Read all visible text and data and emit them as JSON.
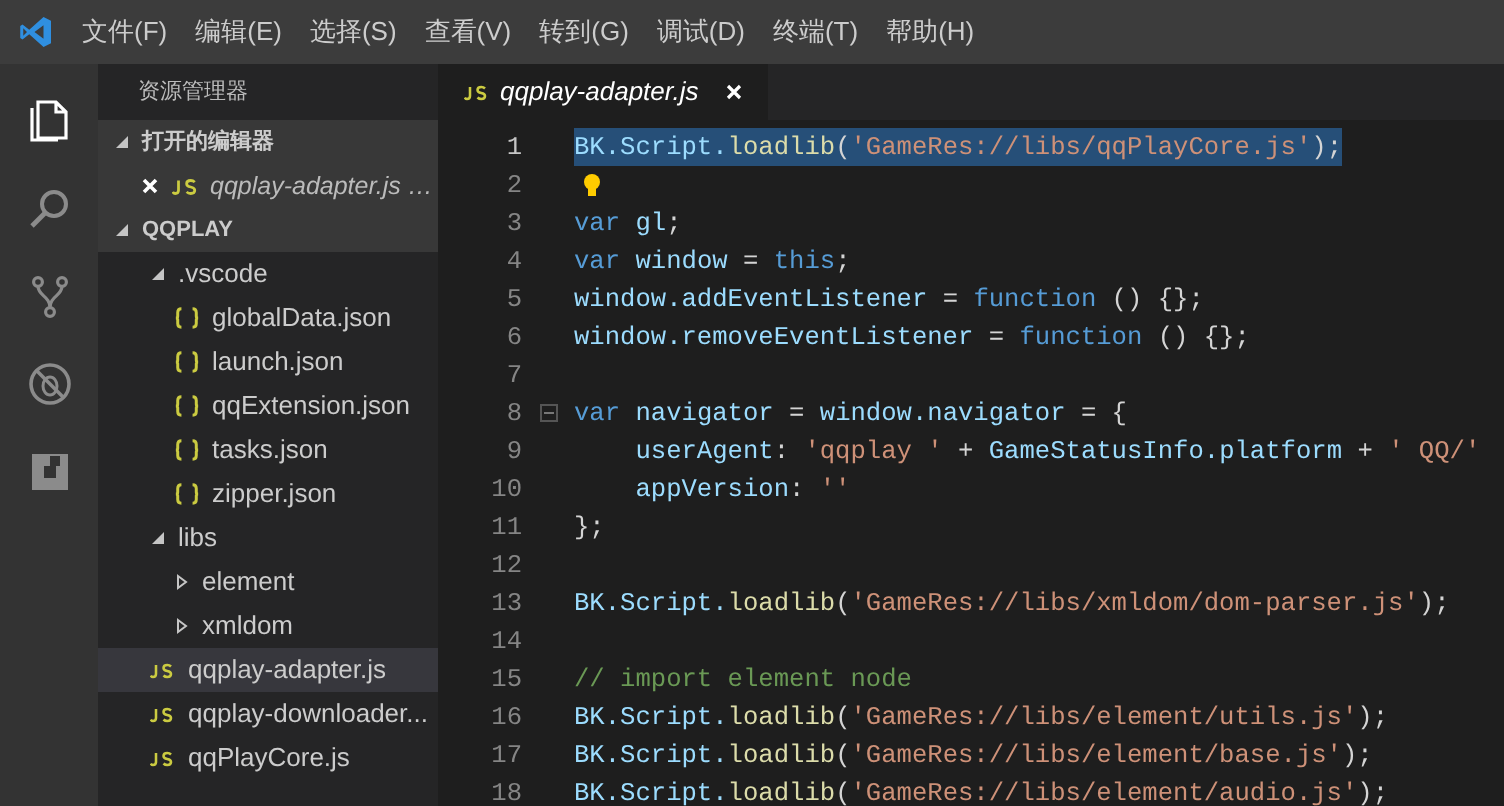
{
  "menu_bar": {
    "items": [
      "文件(F)",
      "编辑(E)",
      "选择(S)",
      "查看(V)",
      "转到(G)",
      "调试(D)",
      "终端(T)",
      "帮助(H)"
    ]
  },
  "activity_bar": {
    "items": [
      {
        "kind": "files",
        "selected": true
      },
      {
        "kind": "search",
        "selected": false
      },
      {
        "kind": "source-control",
        "selected": false
      },
      {
        "kind": "debug",
        "selected": false
      },
      {
        "kind": "extensions",
        "selected": false
      }
    ]
  },
  "sidebar": {
    "title": "资源管理器",
    "open_editors": {
      "title": "打开的编辑器",
      "expanded": true,
      "items": [
        {
          "name": "qqplay-adapter.js …",
          "kind": "js"
        }
      ]
    },
    "project": {
      "title": "QQPLAY",
      "expanded": true,
      "items": [
        {
          "name": ".vscode",
          "kind": "folder",
          "expanded": true,
          "selected": false,
          "children": [
            {
              "name": "globalData.json",
              "kind": "json",
              "selected": false
            },
            {
              "name": "launch.json",
              "kind": "json",
              "selected": false
            },
            {
              "name": "qqExtension.json",
              "kind": "json",
              "selected": false
            },
            {
              "name": "tasks.json",
              "kind": "json",
              "selected": false
            },
            {
              "name": "zipper.json",
              "kind": "json",
              "selected": false
            }
          ]
        },
        {
          "name": "libs",
          "kind": "folder",
          "expanded": true,
          "selected": false,
          "children": [
            {
              "name": "element",
              "kind": "folder",
              "expanded": false,
              "selected": false
            },
            {
              "name": "xmldom",
              "kind": "folder",
              "expanded": false,
              "selected": false
            }
          ]
        },
        {
          "name": "qqplay-adapter.js",
          "kind": "js",
          "selected": true
        },
        {
          "name": "qqplay-downloader...",
          "kind": "js",
          "selected": false
        },
        {
          "name": "qqPlayCore.js",
          "kind": "js",
          "selected": false
        }
      ]
    }
  },
  "tabs": [
    {
      "label": "qqplay-adapter.js",
      "kind": "js",
      "selected": true
    }
  ],
  "editor": {
    "lines": [
      {
        "number": "1",
        "selected": true,
        "bulb": false,
        "fold": false,
        "tokens": [
          {
            "text": "BK.Script.",
            "kind": "var"
          },
          {
            "text": "loadlib",
            "kind": "func"
          },
          {
            "text": "(",
            "kind": "plain"
          },
          {
            "text": "'GameRes://libs/qqPlayCore.js'",
            "kind": "string"
          },
          {
            "text": ");",
            "kind": "plain"
          }
        ]
      },
      {
        "number": "2",
        "selected": false,
        "bulb": true,
        "fold": false
      },
      {
        "number": "3",
        "selected": false,
        "bulb": false,
        "fold": false,
        "tokens": [
          {
            "text": "var",
            "kind": "keyword"
          },
          {
            "text": " gl",
            "kind": "var"
          },
          {
            "text": ";",
            "kind": "plain"
          }
        ]
      },
      {
        "number": "4",
        "selected": false,
        "bulb": false,
        "fold": false,
        "tokens": [
          {
            "text": "var",
            "kind": "keyword"
          },
          {
            "text": " window",
            "kind": "var"
          },
          {
            "text": " = ",
            "kind": "plain"
          },
          {
            "text": "this",
            "kind": "keyword"
          },
          {
            "text": ";",
            "kind": "plain"
          }
        ]
      },
      {
        "number": "5",
        "selected": false,
        "bulb": false,
        "fold": false,
        "tokens": [
          {
            "text": "window.addEventListener",
            "kind": "var"
          },
          {
            "text": " = ",
            "kind": "plain"
          },
          {
            "text": "function",
            "kind": "keyword"
          },
          {
            "text": " () {};",
            "kind": "plain"
          }
        ]
      },
      {
        "number": "6",
        "selected": false,
        "bulb": false,
        "fold": false,
        "tokens": [
          {
            "text": "window.removeEventListener",
            "kind": "var"
          },
          {
            "text": " = ",
            "kind": "plain"
          },
          {
            "text": "function",
            "kind": "keyword"
          },
          {
            "text": " () {};",
            "kind": "plain"
          }
        ]
      },
      {
        "number": "7",
        "selected": false,
        "bulb": false,
        "fold": false
      },
      {
        "number": "8",
        "selected": false,
        "bulb": false,
        "fold": true,
        "tokens": [
          {
            "text": "var",
            "kind": "keyword"
          },
          {
            "text": " navigator",
            "kind": "var"
          },
          {
            "text": " = ",
            "kind": "plain"
          },
          {
            "text": "window.navigator",
            "kind": "var"
          },
          {
            "text": " = {",
            "kind": "plain"
          }
        ]
      },
      {
        "number": "9",
        "selected": false,
        "bulb": false,
        "fold": false,
        "tokens": [
          {
            "text": "    userAgent",
            "kind": "var"
          },
          {
            "text": ": ",
            "kind": "plain"
          },
          {
            "text": "'qqplay '",
            "kind": "string"
          },
          {
            "text": " + ",
            "kind": "plain"
          },
          {
            "text": "GameStatusInfo.platform",
            "kind": "var"
          },
          {
            "text": " + ",
            "kind": "plain"
          },
          {
            "text": "' QQ/'",
            "kind": "string"
          }
        ]
      },
      {
        "number": "10",
        "selected": false,
        "bulb": false,
        "fold": false,
        "tokens": [
          {
            "text": "    appVersion",
            "kind": "var"
          },
          {
            "text": ": ",
            "kind": "plain"
          },
          {
            "text": "''",
            "kind": "string"
          }
        ]
      },
      {
        "number": "11",
        "selected": false,
        "bulb": false,
        "fold": false,
        "tokens": [
          {
            "text": "};",
            "kind": "plain"
          }
        ]
      },
      {
        "number": "12",
        "selected": false,
        "bulb": false,
        "fold": false
      },
      {
        "number": "13",
        "selected": false,
        "bulb": false,
        "fold": false,
        "tokens": [
          {
            "text": "BK.Script.",
            "kind": "var"
          },
          {
            "text": "loadlib",
            "kind": "func"
          },
          {
            "text": "(",
            "kind": "plain"
          },
          {
            "text": "'GameRes://libs/xmldom/dom-parser.js'",
            "kind": "string"
          },
          {
            "text": ");",
            "kind": "plain"
          }
        ]
      },
      {
        "number": "14",
        "selected": false,
        "bulb": false,
        "fold": false
      },
      {
        "number": "15",
        "selected": false,
        "bulb": false,
        "fold": false,
        "tokens": [
          {
            "text": "// import element node",
            "kind": "comment"
          }
        ]
      },
      {
        "number": "16",
        "selected": false,
        "bulb": false,
        "fold": false,
        "tokens": [
          {
            "text": "BK.Script.",
            "kind": "var"
          },
          {
            "text": "loadlib",
            "kind": "func"
          },
          {
            "text": "(",
            "kind": "plain"
          },
          {
            "text": "'GameRes://libs/element/utils.js'",
            "kind": "string"
          },
          {
            "text": ");",
            "kind": "plain"
          }
        ]
      },
      {
        "number": "17",
        "selected": false,
        "bulb": false,
        "fold": false,
        "tokens": [
          {
            "text": "BK.Script.",
            "kind": "var"
          },
          {
            "text": "loadlib",
            "kind": "func"
          },
          {
            "text": "(",
            "kind": "plain"
          },
          {
            "text": "'GameRes://libs/element/base.js'",
            "kind": "string"
          },
          {
            "text": ");",
            "kind": "plain"
          }
        ]
      },
      {
        "number": "18",
        "selected": false,
        "bulb": false,
        "fold": false,
        "tokens": [
          {
            "text": "BK.Script.",
            "kind": "var"
          },
          {
            "text": "loadlib",
            "kind": "func"
          },
          {
            "text": "(",
            "kind": "plain"
          },
          {
            "text": "'GameRes://libs/element/audio.js'",
            "kind": "string"
          },
          {
            "text": ");",
            "kind": "plain"
          }
        ]
      }
    ]
  }
}
